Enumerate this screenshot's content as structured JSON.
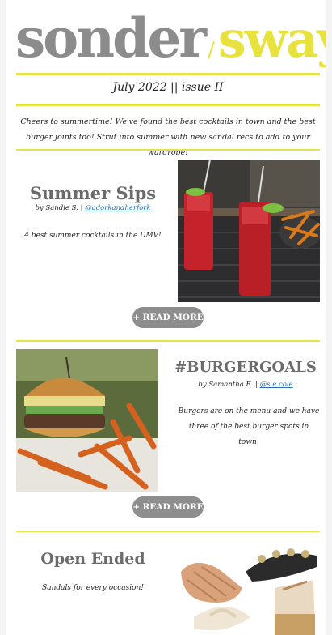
{
  "brand": {
    "word1": "sonder",
    "separator": "/",
    "word2": "sway",
    "accent": "#e8e23c",
    "gray": "#8c8c8c"
  },
  "issue_line": "July 2022 || issue II",
  "intro": "Cheers to summertime! We've found the best cocktails in town and the best burger joints too! Strut into summer with new sandal recs to add to your wardrobe!",
  "sections": [
    {
      "title": "Summer Sips",
      "byline_prefix": "by Sandie S. | ",
      "byline_handle": "@adorkandherfork",
      "blurb": "4 best summer cocktails in the DMV!",
      "button": "+ READ MORE",
      "image": "cocktails-photo"
    },
    {
      "title": "#BURGERGOALS",
      "byline_prefix": "by Samantha E. | ",
      "byline_handle": "@s.e.cole",
      "blurb": "Burgers are on the menu and we have three of the best burger spots in town.",
      "button": "+ READ MORE",
      "image": "burger-photo"
    },
    {
      "title": "Open Ended",
      "blurb": "Sandals for every occasion!",
      "image": "sandals-photo"
    }
  ]
}
